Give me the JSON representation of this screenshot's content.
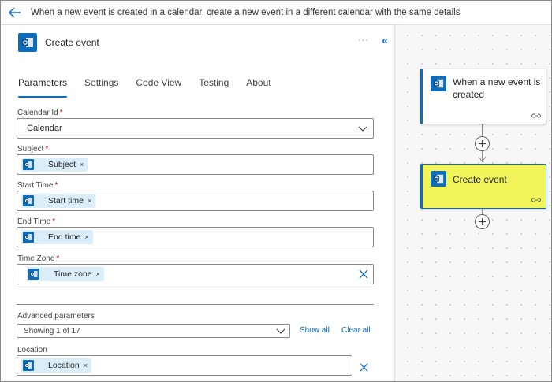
{
  "topbar": {
    "back_icon": "arrow-left-icon",
    "flow_title": "When a new event is created in a calendar, create a new event in a different calendar with the same details"
  },
  "panel": {
    "title": "Create event",
    "app_icon": "outlook-icon",
    "more_label": "···",
    "collapse_label": "«",
    "tabs": [
      {
        "label": "Parameters",
        "active": true
      },
      {
        "label": "Settings",
        "active": false
      },
      {
        "label": "Code View",
        "active": false
      },
      {
        "label": "Testing",
        "active": false
      },
      {
        "label": "About",
        "active": false
      }
    ],
    "fields": {
      "calendar_id": {
        "label": "Calendar Id",
        "required": "*",
        "value": "Calendar"
      },
      "subject": {
        "label": "Subject",
        "required": "*",
        "token": "Subject"
      },
      "start_time": {
        "label": "Start Time",
        "required": "*",
        "token": "Start time"
      },
      "end_time": {
        "label": "End Time",
        "required": "*",
        "token": "End time"
      },
      "time_zone": {
        "label": "Time Zone",
        "required": "*",
        "token": "Time zone"
      }
    },
    "token_remove": "×",
    "advanced": {
      "label": "Advanced parameters",
      "value": "Showing 1 of 17",
      "show_all": "Show all",
      "clear_all": "Clear all"
    },
    "location": {
      "label": "Location",
      "token": "Location"
    }
  },
  "canvas": {
    "trigger_title": "When a new event is created",
    "action_title": "Create event",
    "colors": {
      "accent": "#0f6cbd",
      "selected_highlight": "#f2f55a"
    }
  }
}
